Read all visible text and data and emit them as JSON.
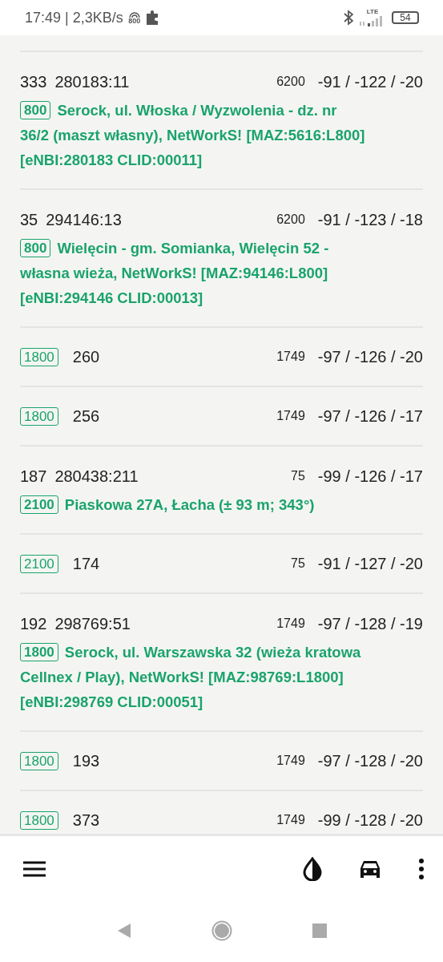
{
  "status_bar": {
    "time_speed": "17:49 | 2,3KB/s",
    "hotspot_label": "800",
    "network": "LTE",
    "battery": "54"
  },
  "entries": [
    {
      "kind": "cell",
      "pci": "333",
      "cell_id": "280183:11",
      "earfcn": "6200",
      "signal": "-91 / -122 / -20",
      "band": "800",
      "location_lines": [
        "Serock, ul. Włoska / Wyzwolenia - dz. nr",
        "36/2 (maszt własny), NetWorkS! [MAZ:5616:L800]",
        "[eNBI:280183 CLID:00011]"
      ]
    },
    {
      "kind": "cell",
      "pci": "35",
      "cell_id": "294146:13",
      "earfcn": "6200",
      "signal": "-91 / -123 / -18",
      "band": "800",
      "location_lines": [
        "Wielęcin - gm. Somianka, Wielęcin 52 -",
        "własna wieża, NetWorkS! [MAZ:94146:L800]",
        "[eNBI:294146 CLID:00013]"
      ]
    },
    {
      "kind": "neighbor",
      "band": "1800",
      "pci": "260",
      "earfcn": "1749",
      "signal": "-97 / -126 / -20"
    },
    {
      "kind": "neighbor",
      "band": "1800",
      "pci": "256",
      "earfcn": "1749",
      "signal": "-97 / -126 / -17"
    },
    {
      "kind": "cell",
      "pci": "187",
      "cell_id": "280438:211",
      "earfcn": "75",
      "signal": "-99 / -126 / -17",
      "band": "2100",
      "location_lines": [
        "Piaskowa 27A, Łacha (± 93 m; 343°)"
      ]
    },
    {
      "kind": "neighbor",
      "band": "2100",
      "pci": "174",
      "earfcn": "75",
      "signal": "-91 / -127 / -20"
    },
    {
      "kind": "cell",
      "pci": "192",
      "cell_id": "298769:51",
      "earfcn": "1749",
      "signal": "-97 / -128 / -19",
      "band": "1800",
      "location_lines": [
        "Serock, ul. Warszawska 32 (wieża kratowa",
        "Cellnex / Play), NetWorkS! [MAZ:98769:L1800]",
        "[eNBI:298769 CLID:00051]"
      ]
    },
    {
      "kind": "neighbor",
      "band": "1800",
      "pci": "193",
      "earfcn": "1749",
      "signal": "-97 / -128 / -20"
    },
    {
      "kind": "neighbor",
      "band": "1800",
      "pci": "373",
      "earfcn": "1749",
      "signal": "-99 / -128 / -20"
    }
  ]
}
